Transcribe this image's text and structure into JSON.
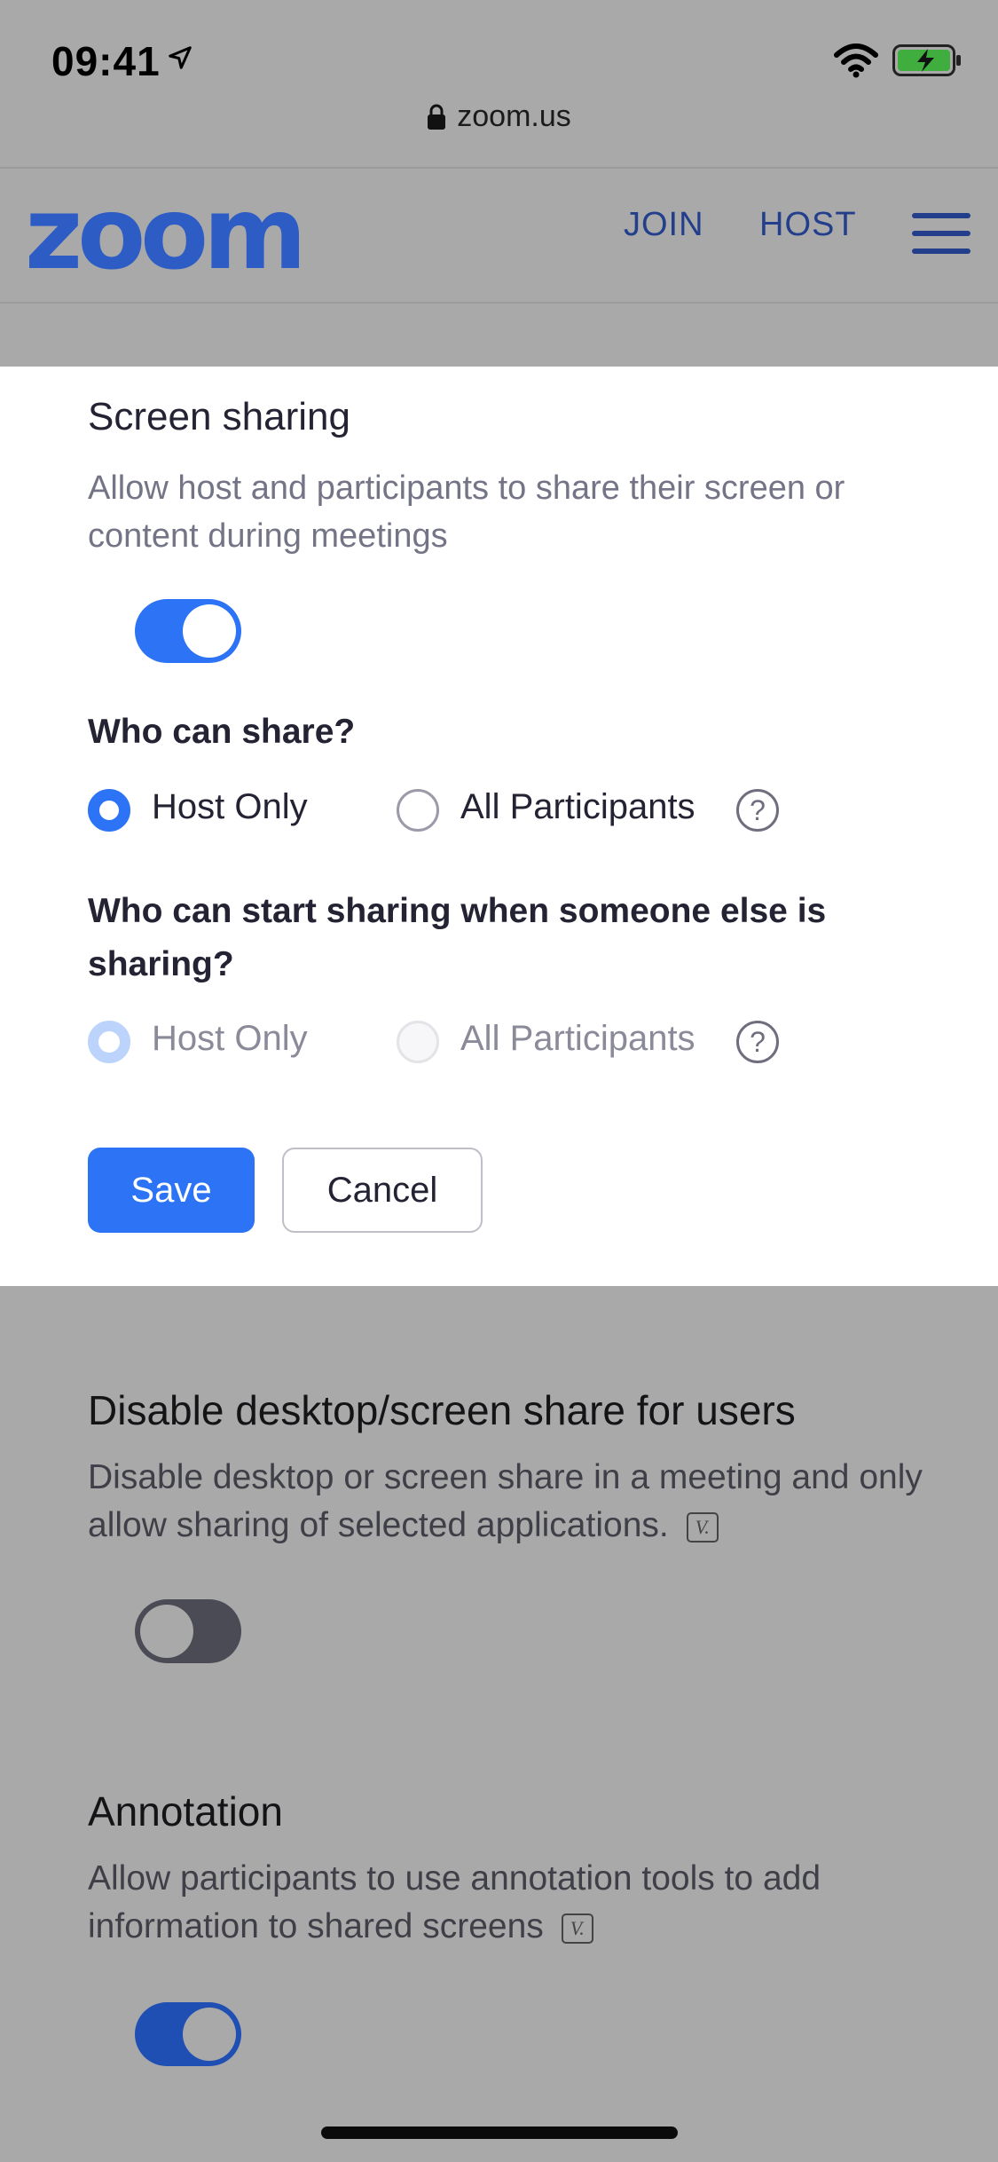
{
  "status_bar": {
    "time": "09:41",
    "icons": [
      "location-arrow-icon",
      "wifi-icon",
      "battery-charging-icon"
    ]
  },
  "browser": {
    "url": "zoom.us",
    "lock_icon": "lock-icon"
  },
  "header": {
    "logo_text": "zoom",
    "nav": {
      "join": "JOIN",
      "host": "HOST"
    },
    "menu_icon": "hamburger-menu-icon",
    "brand_color": "#2d5cc5"
  },
  "screen_sharing": {
    "title": "Screen sharing",
    "description": "Allow host and participants to share their screen or content during meetings",
    "enabled": true,
    "who_can_share": {
      "label": "Who can share?",
      "options": [
        "Host Only",
        "All Participants"
      ],
      "selected": "Host Only"
    },
    "who_can_start": {
      "label": "Who can start sharing when someone else is sharing?",
      "options": [
        "Host Only",
        "All Participants"
      ],
      "selected": "Host Only",
      "disabled": true
    },
    "save_label": "Save",
    "cancel_label": "Cancel"
  },
  "disable_desktop_share": {
    "title": "Disable desktop/screen share for users",
    "description": "Disable desktop or screen share in a meeting and only allow sharing of selected applications.",
    "badge": "V.",
    "enabled": false
  },
  "annotation": {
    "title": "Annotation",
    "description": "Allow participants to use annotation tools to add information to shared screens",
    "badge": "V.",
    "enabled": true
  },
  "colors": {
    "accent": "#2d73f5",
    "overlay": "#a9a9aa",
    "toggle_off": "#4b4b55",
    "toggle_on_dimmed": "#1f4fb3"
  }
}
